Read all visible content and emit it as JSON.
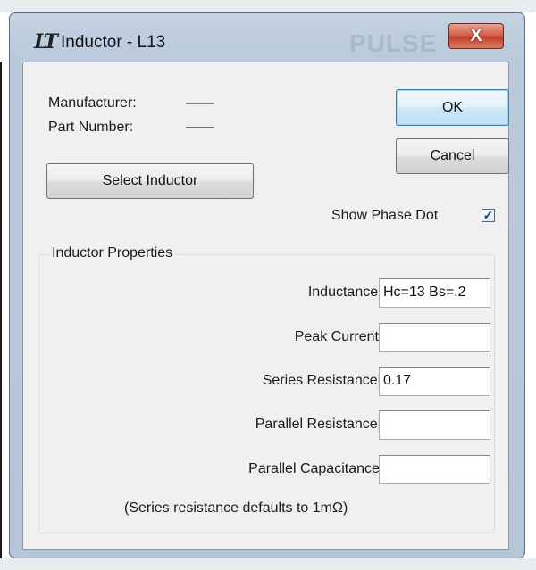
{
  "window": {
    "title": "Inductor - L13",
    "close_glyph": "X",
    "background_text": "PULSE"
  },
  "info": {
    "manufacturer_label": "Manufacturer:",
    "manufacturer_value": "——",
    "part_number_label": "Part Number:",
    "part_number_value": "——"
  },
  "buttons": {
    "ok": "OK",
    "cancel": "Cancel",
    "select_inductor": "Select Inductor"
  },
  "show_phase_dot": {
    "label": "Show Phase Dot",
    "checked": true,
    "check_glyph": "✓"
  },
  "properties": {
    "group_title": "Inductor Properties",
    "inductance_label": "Inductance[H]:",
    "inductance_value": "Hc=13 Bs=.2",
    "peak_current_label": "Peak Current[A]:",
    "peak_current_value": "",
    "series_resistance_label": "Series Resistance[Ω]:",
    "series_resistance_value": "0.17",
    "parallel_resistance_label": "Parallel Resistance[Ω]:",
    "parallel_resistance_value": "",
    "parallel_capacitance_label": "Parallel Capacitance[F]:",
    "parallel_capacitance_value": "",
    "note": "(Series resistance defaults to 1mΩ)"
  },
  "colors": {
    "title_bar": "#b9cadb",
    "close_button": "#c9503a",
    "dialog_bg": "#f0f0f0",
    "default_button_border": "#3c7fb1"
  }
}
